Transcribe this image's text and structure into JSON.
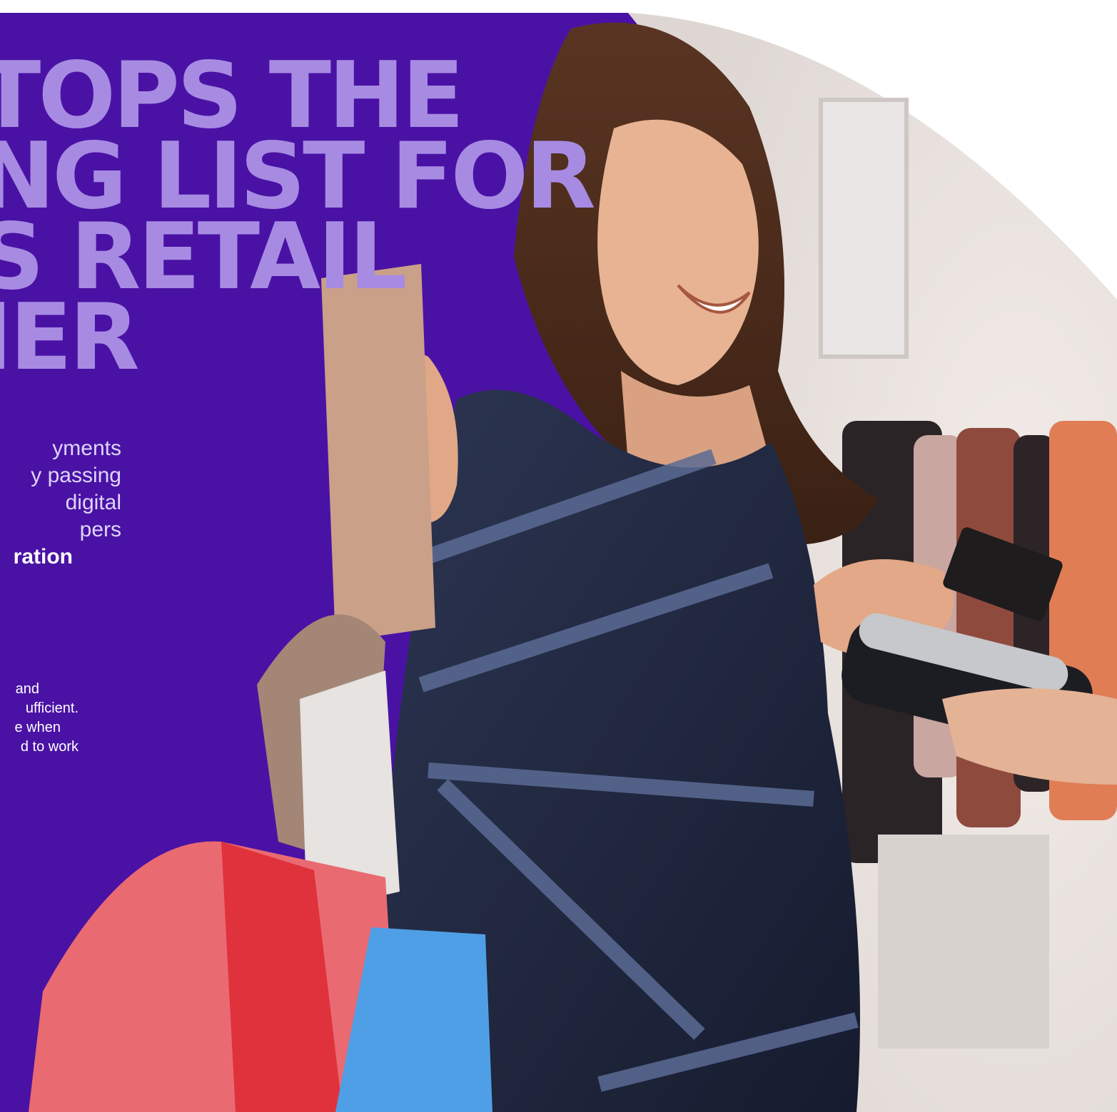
{
  "headline": {
    "lines": [
      "TOPS THE",
      "NG LIST FOR",
      "S RETAIL",
      "IER"
    ]
  },
  "intro": {
    "lines": [
      "yments",
      "y passing",
      "digital",
      "pers"
    ],
    "emphasis": "ration"
  },
  "body": {
    "lines": [
      "and",
      "ufficient.",
      "e when",
      "d to work"
    ]
  },
  "colors": {
    "panel": "#4a12a4",
    "headline": "#a78be3",
    "intro_text": "#ded5fb",
    "body_text": "#ffffff"
  },
  "photo": {
    "subject": "woman-with-shopping-bags-paying-by-card",
    "elements": [
      "shopping-bags",
      "credit-card",
      "card-terminal",
      "clothing-rack"
    ]
  }
}
